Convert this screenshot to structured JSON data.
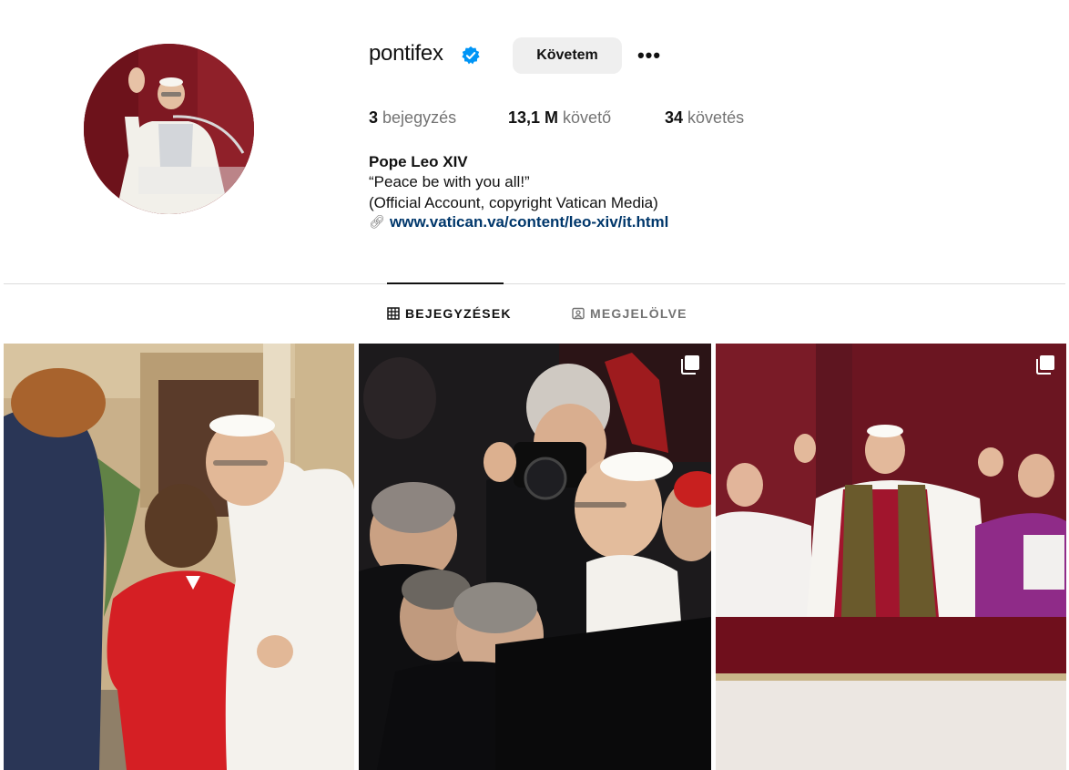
{
  "profile": {
    "username": "pontifex",
    "verified": true,
    "follow_label": "Követem",
    "more_label": "•••",
    "stats": {
      "posts_count": "3",
      "posts_label": "bejegyzés",
      "followers_count": "13,1 M",
      "followers_label": "követő",
      "following_count": "34",
      "following_label": "követés"
    },
    "bio": {
      "name": "Pope Leo XIV",
      "line1": "“Peace be with you all!”",
      "line2": "(Official Account, copyright Vatican Media)",
      "link": "www.vatican.va/content/leo-xiv/it.html"
    }
  },
  "tabs": [
    {
      "label": "BEJEGYZÉSEK",
      "icon": "grid-icon",
      "active": true
    },
    {
      "label": "MEGJELÖLVE",
      "icon": "tagged-icon",
      "active": false
    }
  ],
  "posts": [
    {
      "icon": null
    },
    {
      "icon": "multiple-posts-icon"
    },
    {
      "icon": "multiple-posts-icon"
    }
  ],
  "colors": {
    "verified_blue": "#0095f6",
    "link_blue": "#00376b",
    "button_gray": "#efefef",
    "muted_text": "#737373"
  }
}
